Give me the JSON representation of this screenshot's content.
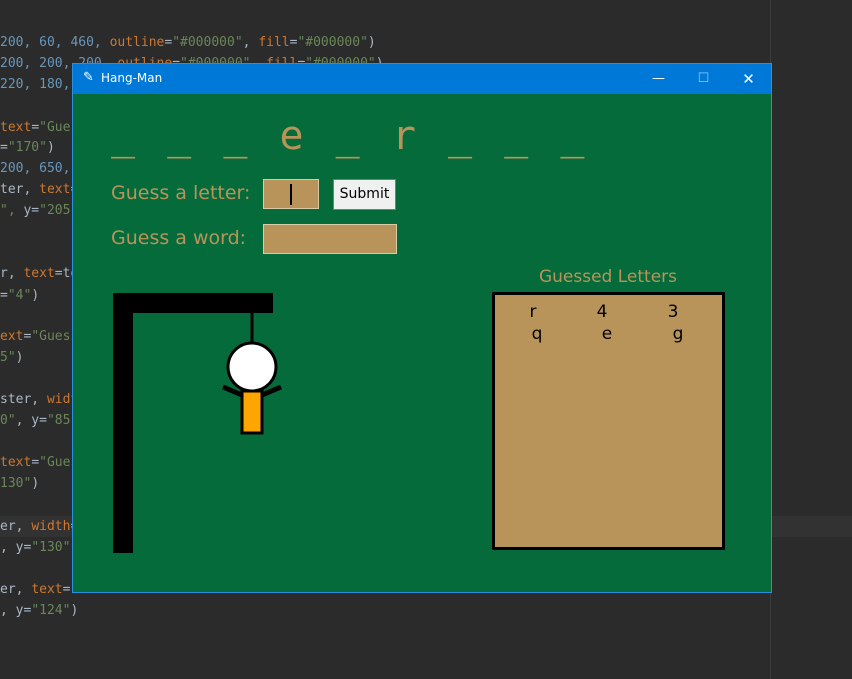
{
  "editor": {
    "lines": [
      {
        "segments": [
          {
            "t": "200, 60, 460, ",
            "c": "num"
          },
          {
            "t": "outline",
            "c": "kw"
          },
          {
            "t": "=",
            "c": ""
          },
          {
            "t": "\"#000000\"",
            "c": "str"
          },
          {
            "t": ", ",
            "c": ""
          },
          {
            "t": "fill",
            "c": "kw"
          },
          {
            "t": "=",
            "c": ""
          },
          {
            "t": "\"#000000\"",
            "c": "str"
          },
          {
            "t": ")",
            "c": ""
          }
        ]
      },
      {
        "segments": [
          {
            "t": "200, 200, 200, ",
            "c": "num"
          },
          {
            "t": "outline",
            "c": "kw"
          },
          {
            "t": "=",
            "c": ""
          },
          {
            "t": "\"#000000\"",
            "c": "str"
          },
          {
            "t": ", ",
            "c": ""
          },
          {
            "t": "fill",
            "c": "kw"
          },
          {
            "t": "=",
            "c": ""
          },
          {
            "t": "\"#000000\"",
            "c": "str"
          },
          {
            "t": ")",
            "c": ""
          }
        ]
      },
      {
        "segments": [
          {
            "t": "220, 180, ",
            "c": "num"
          }
        ]
      },
      {
        "segments": [
          {
            "t": "text",
            "c": "kw"
          },
          {
            "t": "=",
            "c": ""
          },
          {
            "t": "\"Gue",
            "c": "str"
          }
        ]
      },
      {
        "segments": [
          {
            "t": "=",
            "c": ""
          },
          {
            "t": "\"170\"",
            "c": "str"
          },
          {
            "t": ")",
            "c": ""
          }
        ]
      },
      {
        "segments": [
          {
            "t": "200, 650,",
            "c": "num"
          }
        ]
      },
      {
        "segments": [
          {
            "t": "ter, ",
            "c": ""
          },
          {
            "t": "text",
            "c": "kw"
          },
          {
            "t": "=",
            "c": ""
          }
        ]
      },
      {
        "segments": [
          {
            "t": "\", ",
            "c": "str"
          },
          {
            "t": "y=",
            "c": ""
          },
          {
            "t": "\"205",
            "c": "str"
          }
        ]
      },
      {
        "segments": [
          {
            "t": "r, ",
            "c": ""
          },
          {
            "t": "text",
            "c": "kw"
          },
          {
            "t": "=to",
            "c": ""
          }
        ]
      },
      {
        "segments": [
          {
            "t": "=",
            "c": ""
          },
          {
            "t": "\"4\"",
            "c": "str"
          },
          {
            "t": ")",
            "c": ""
          }
        ]
      },
      {
        "segments": [
          {
            "t": "ext",
            "c": "kw"
          },
          {
            "t": "=",
            "c": ""
          },
          {
            "t": "\"Guess",
            "c": "str"
          }
        ]
      },
      {
        "segments": [
          {
            "t": "5\"",
            "c": "str"
          },
          {
            "t": ")",
            "c": ""
          }
        ]
      },
      {
        "segments": [
          {
            "t": "ster, ",
            "c": ""
          },
          {
            "t": "widt",
            "c": "kw"
          }
        ]
      },
      {
        "segments": [
          {
            "t": "0\"",
            "c": "str"
          },
          {
            "t": ", y=",
            "c": ""
          },
          {
            "t": "\"85",
            "c": "str"
          }
        ]
      },
      {
        "segments": [
          {
            "t": "text",
            "c": "kw"
          },
          {
            "t": "=",
            "c": ""
          },
          {
            "t": "\"Gues",
            "c": "str"
          }
        ]
      },
      {
        "segments": [
          {
            "t": "130\"",
            "c": "str"
          },
          {
            "t": ")",
            "c": ""
          }
        ]
      },
      {
        "segments": [
          {
            "t": "er, ",
            "c": ""
          },
          {
            "t": "width",
            "c": "kw"
          },
          {
            "t": "=",
            "c": ""
          }
        ]
      },
      {
        "segments": [
          {
            "t": ", y=",
            "c": ""
          },
          {
            "t": "\"130\"",
            "c": "str"
          }
        ]
      },
      {
        "segments": [
          {
            "t": "er, ",
            "c": ""
          },
          {
            "t": "text",
            "c": "kw"
          },
          {
            "t": "=",
            "c": ""
          }
        ]
      },
      {
        "segments": [
          {
            "t": ", y=",
            "c": ""
          },
          {
            "t": "\"124\"",
            "c": "str"
          },
          {
            "t": ")",
            "c": ""
          }
        ]
      }
    ]
  },
  "window": {
    "title": "Hang-Man",
    "minimize_label": "—",
    "maximize_label": "☐",
    "close_label": "✕"
  },
  "game": {
    "word_display": "_ _ _ e _ r _ _ _",
    "guess_letter_label": "Guess a letter:",
    "guess_word_label": "Guess a word:",
    "letter_input_value": "",
    "word_input_value": "",
    "submit_label": "Submit",
    "guessed_title": "Guessed Letters",
    "guessed_letters": [
      "r",
      "4",
      "3",
      "q",
      "e",
      "g"
    ],
    "colors": {
      "background": "#066b3b",
      "accent": "#b8945a",
      "body": "#ffa500"
    }
  }
}
